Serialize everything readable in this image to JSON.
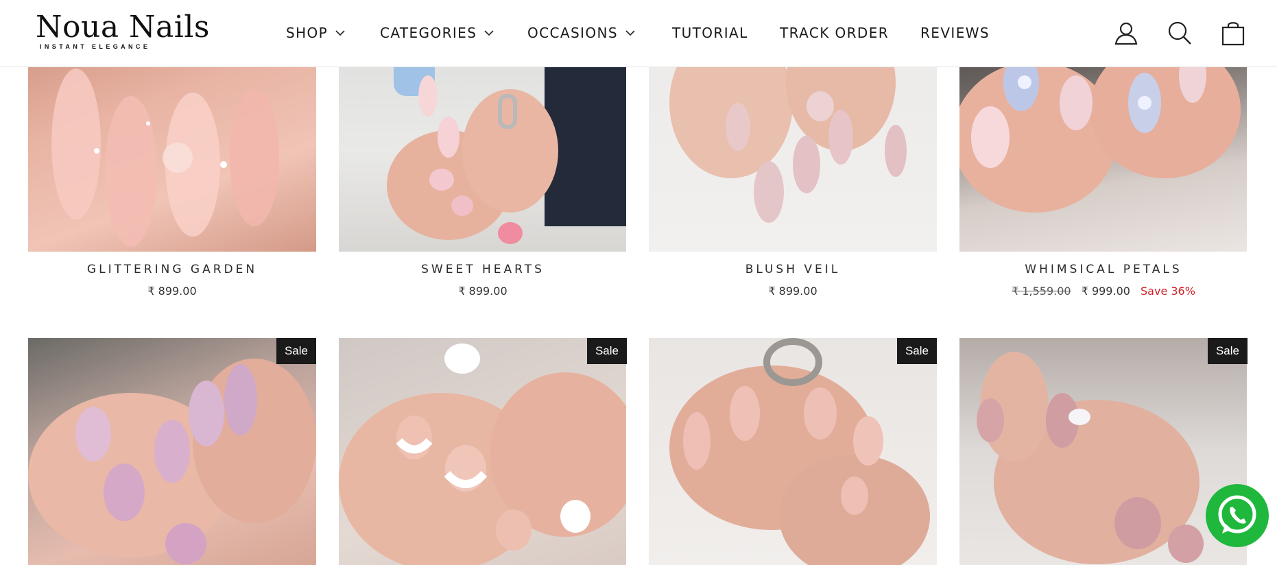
{
  "brand": {
    "name": "Noua Nails",
    "tagline": "INSTANT ELEGANCE"
  },
  "nav": [
    {
      "label": "SHOP",
      "dropdown": true
    },
    {
      "label": "CATEGORIES",
      "dropdown": true
    },
    {
      "label": "OCCASIONS",
      "dropdown": true
    },
    {
      "label": "TUTORIAL",
      "dropdown": false
    },
    {
      "label": "TRACK ORDER",
      "dropdown": false
    },
    {
      "label": "REVIEWS",
      "dropdown": false
    }
  ],
  "header_icons": [
    "account-icon",
    "search-icon",
    "cart-icon"
  ],
  "products_row1": [
    {
      "title": "GLITTERING GARDEN",
      "price": "₹ 899.00"
    },
    {
      "title": "SWEET HEARTS",
      "price": "₹ 899.00"
    },
    {
      "title": "BLUSH VEIL",
      "price": "₹ 899.00"
    },
    {
      "title": "WHIMSICAL PETALS",
      "compare_price": "₹ 1,559.00",
      "price": "₹ 999.00",
      "save": "Save 36%"
    }
  ],
  "products_row2": [
    {
      "badge": "Sale"
    },
    {
      "badge": "Sale"
    },
    {
      "badge": "Sale"
    },
    {
      "badge": "Sale"
    }
  ],
  "colors": {
    "sale_badge": "#1a1a1a",
    "save_text": "#d1222a",
    "whatsapp": "#1fb83d"
  },
  "floating": {
    "icon": "whatsapp-icon"
  }
}
